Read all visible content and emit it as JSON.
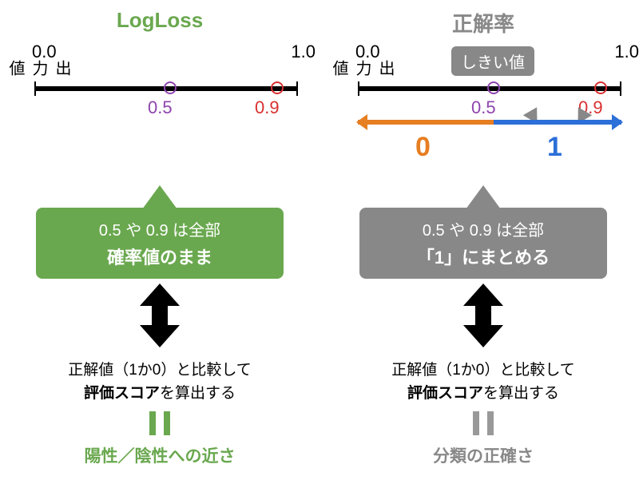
{
  "left": {
    "title": "LogLoss",
    "axis_label": "出力値",
    "tick0": "0.0",
    "tick1": "1.0",
    "val05": "0.5",
    "val09": "0.9",
    "callout_l1": "0.5 や 0.9 は全部",
    "callout_l2": "確率値のまま",
    "compare_l1": "正解値（1か0）と比較して",
    "compare_l2a": "評価スコア",
    "compare_l2b": "を算出する",
    "result": "陽性／陰性への近さ"
  },
  "right": {
    "title": "正解率",
    "axis_label": "出力値",
    "tick0": "0.0",
    "tick1": "1.0",
    "val05": "0.5",
    "val09": "0.9",
    "threshold": "しきい値",
    "zone0": "0",
    "zone1": "1",
    "callout_l1": "0.5 や 0.9 は全部",
    "callout_l2": "「1」にまとめる",
    "compare_l1": "正解値（1か0）と比較して",
    "compare_l2a": "評価スコア",
    "compare_l2b": "を算出する",
    "result": "分類の正確さ"
  }
}
